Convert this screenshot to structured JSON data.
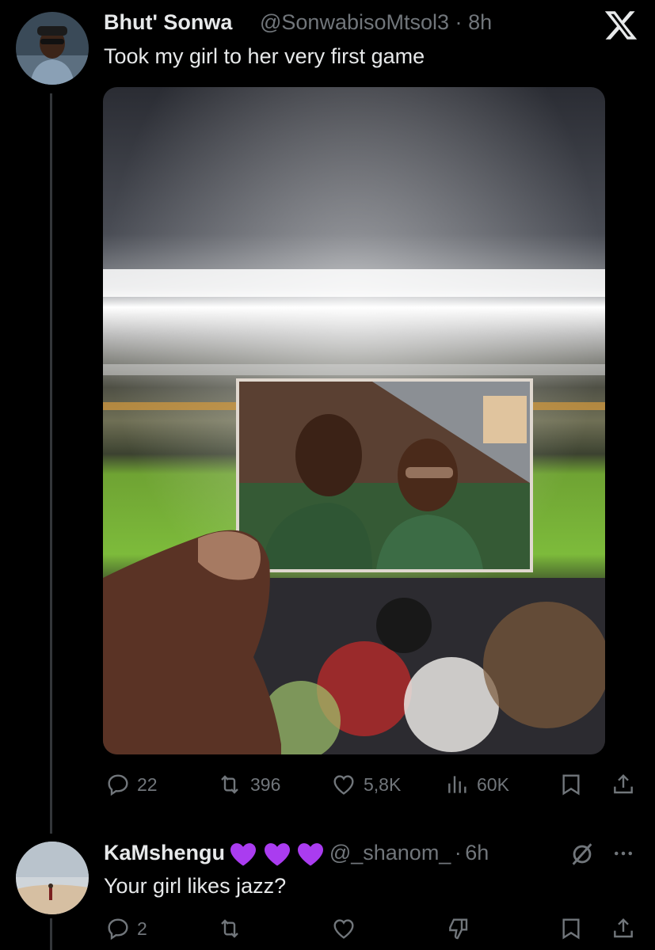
{
  "main_post": {
    "author_name": "Bhut' Sonwa",
    "handle": "@SonwabisoMtsol3",
    "separator": "·",
    "time": "8h",
    "text": "Took my girl to her very first game",
    "stats": {
      "replies": "22",
      "reposts": "396",
      "likes": "5,8K",
      "views": "60K"
    }
  },
  "reply_post": {
    "author_name": "KaMshengu",
    "handle": "@_shanom_",
    "separator": "·",
    "time": "6h",
    "text": "Your girl likes jazz?",
    "stats": {
      "replies": "2"
    }
  },
  "icons": {
    "logo": "x-logo",
    "reply": "reply-icon",
    "repost": "repost-icon",
    "like": "heart-icon",
    "views": "views-icon",
    "bookmark": "bookmark-icon",
    "share": "share-icon",
    "more": "more-icon",
    "grok": "grok-icon",
    "dislike": "dislike-icon",
    "purple_heart": "purple-heart-emoji"
  },
  "colors": {
    "background": "#000000",
    "text": "#e7e9ea",
    "muted": "#71767b",
    "emoji_purple": "#aa3cf0"
  }
}
